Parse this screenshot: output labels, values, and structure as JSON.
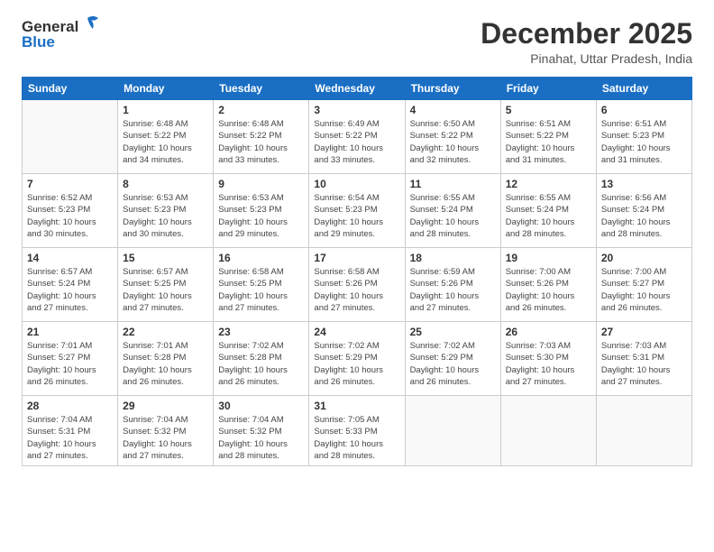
{
  "logo": {
    "line1": "General",
    "line2": "Blue"
  },
  "title": "December 2025",
  "subtitle": "Pinahat, Uttar Pradesh, India",
  "weekdays": [
    "Sunday",
    "Monday",
    "Tuesday",
    "Wednesday",
    "Thursday",
    "Friday",
    "Saturday"
  ],
  "weeks": [
    [
      {
        "day": "",
        "info": ""
      },
      {
        "day": "1",
        "info": "Sunrise: 6:48 AM\nSunset: 5:22 PM\nDaylight: 10 hours\nand 34 minutes."
      },
      {
        "day": "2",
        "info": "Sunrise: 6:48 AM\nSunset: 5:22 PM\nDaylight: 10 hours\nand 33 minutes."
      },
      {
        "day": "3",
        "info": "Sunrise: 6:49 AM\nSunset: 5:22 PM\nDaylight: 10 hours\nand 33 minutes."
      },
      {
        "day": "4",
        "info": "Sunrise: 6:50 AM\nSunset: 5:22 PM\nDaylight: 10 hours\nand 32 minutes."
      },
      {
        "day": "5",
        "info": "Sunrise: 6:51 AM\nSunset: 5:22 PM\nDaylight: 10 hours\nand 31 minutes."
      },
      {
        "day": "6",
        "info": "Sunrise: 6:51 AM\nSunset: 5:23 PM\nDaylight: 10 hours\nand 31 minutes."
      }
    ],
    [
      {
        "day": "7",
        "info": "Sunrise: 6:52 AM\nSunset: 5:23 PM\nDaylight: 10 hours\nand 30 minutes."
      },
      {
        "day": "8",
        "info": "Sunrise: 6:53 AM\nSunset: 5:23 PM\nDaylight: 10 hours\nand 30 minutes."
      },
      {
        "day": "9",
        "info": "Sunrise: 6:53 AM\nSunset: 5:23 PM\nDaylight: 10 hours\nand 29 minutes."
      },
      {
        "day": "10",
        "info": "Sunrise: 6:54 AM\nSunset: 5:23 PM\nDaylight: 10 hours\nand 29 minutes."
      },
      {
        "day": "11",
        "info": "Sunrise: 6:55 AM\nSunset: 5:24 PM\nDaylight: 10 hours\nand 28 minutes."
      },
      {
        "day": "12",
        "info": "Sunrise: 6:55 AM\nSunset: 5:24 PM\nDaylight: 10 hours\nand 28 minutes."
      },
      {
        "day": "13",
        "info": "Sunrise: 6:56 AM\nSunset: 5:24 PM\nDaylight: 10 hours\nand 28 minutes."
      }
    ],
    [
      {
        "day": "14",
        "info": "Sunrise: 6:57 AM\nSunset: 5:24 PM\nDaylight: 10 hours\nand 27 minutes."
      },
      {
        "day": "15",
        "info": "Sunrise: 6:57 AM\nSunset: 5:25 PM\nDaylight: 10 hours\nand 27 minutes."
      },
      {
        "day": "16",
        "info": "Sunrise: 6:58 AM\nSunset: 5:25 PM\nDaylight: 10 hours\nand 27 minutes."
      },
      {
        "day": "17",
        "info": "Sunrise: 6:58 AM\nSunset: 5:26 PM\nDaylight: 10 hours\nand 27 minutes."
      },
      {
        "day": "18",
        "info": "Sunrise: 6:59 AM\nSunset: 5:26 PM\nDaylight: 10 hours\nand 27 minutes."
      },
      {
        "day": "19",
        "info": "Sunrise: 7:00 AM\nSunset: 5:26 PM\nDaylight: 10 hours\nand 26 minutes."
      },
      {
        "day": "20",
        "info": "Sunrise: 7:00 AM\nSunset: 5:27 PM\nDaylight: 10 hours\nand 26 minutes."
      }
    ],
    [
      {
        "day": "21",
        "info": "Sunrise: 7:01 AM\nSunset: 5:27 PM\nDaylight: 10 hours\nand 26 minutes."
      },
      {
        "day": "22",
        "info": "Sunrise: 7:01 AM\nSunset: 5:28 PM\nDaylight: 10 hours\nand 26 minutes."
      },
      {
        "day": "23",
        "info": "Sunrise: 7:02 AM\nSunset: 5:28 PM\nDaylight: 10 hours\nand 26 minutes."
      },
      {
        "day": "24",
        "info": "Sunrise: 7:02 AM\nSunset: 5:29 PM\nDaylight: 10 hours\nand 26 minutes."
      },
      {
        "day": "25",
        "info": "Sunrise: 7:02 AM\nSunset: 5:29 PM\nDaylight: 10 hours\nand 26 minutes."
      },
      {
        "day": "26",
        "info": "Sunrise: 7:03 AM\nSunset: 5:30 PM\nDaylight: 10 hours\nand 27 minutes."
      },
      {
        "day": "27",
        "info": "Sunrise: 7:03 AM\nSunset: 5:31 PM\nDaylight: 10 hours\nand 27 minutes."
      }
    ],
    [
      {
        "day": "28",
        "info": "Sunrise: 7:04 AM\nSunset: 5:31 PM\nDaylight: 10 hours\nand 27 minutes."
      },
      {
        "day": "29",
        "info": "Sunrise: 7:04 AM\nSunset: 5:32 PM\nDaylight: 10 hours\nand 27 minutes."
      },
      {
        "day": "30",
        "info": "Sunrise: 7:04 AM\nSunset: 5:32 PM\nDaylight: 10 hours\nand 28 minutes."
      },
      {
        "day": "31",
        "info": "Sunrise: 7:05 AM\nSunset: 5:33 PM\nDaylight: 10 hours\nand 28 minutes."
      },
      {
        "day": "",
        "info": ""
      },
      {
        "day": "",
        "info": ""
      },
      {
        "day": "",
        "info": ""
      }
    ]
  ]
}
